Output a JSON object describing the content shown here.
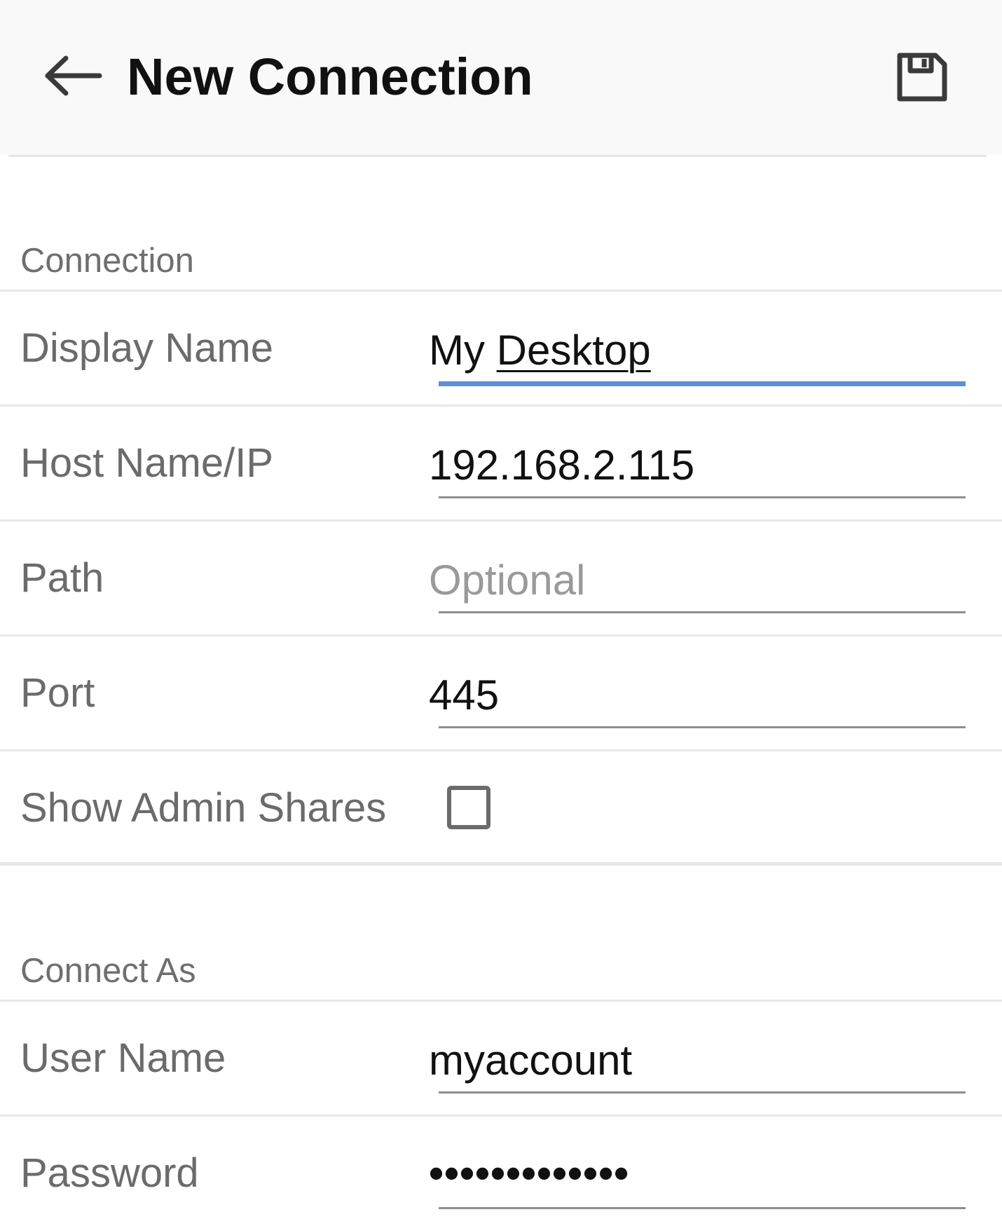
{
  "appbar": {
    "title": "New Connection",
    "back_icon": "arrow-left-icon",
    "save_icon": "floppy-disk-icon"
  },
  "connection": {
    "header": "Connection",
    "display_name": {
      "label": "Display Name",
      "value_prefix": "My ",
      "value_word": "Desktop"
    },
    "host": {
      "label": "Host Name/IP",
      "value": "192.168.2.115"
    },
    "path": {
      "label": "Path",
      "placeholder": "Optional",
      "value": ""
    },
    "port": {
      "label": "Port",
      "value": "445"
    },
    "admin_shares": {
      "label": "Show Admin Shares",
      "checked": false
    }
  },
  "connect_as": {
    "header": "Connect As",
    "user": {
      "label": "User Name",
      "value": "myaccount"
    },
    "password": {
      "label": "Password",
      "value": "•••••••••••••"
    }
  },
  "colors": {
    "focus_underline": "#5b8fdc",
    "appbar_bg": "#f9f9f9",
    "label": "#6b6b6b"
  }
}
